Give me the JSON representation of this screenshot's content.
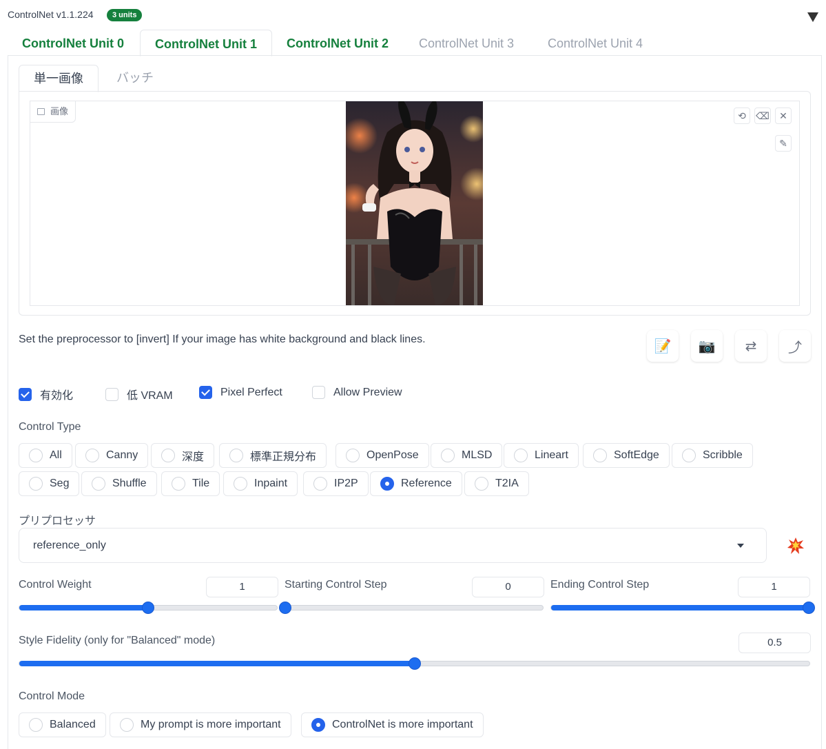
{
  "header": {
    "title": "ControlNet v1.1.224",
    "badge": "3 units"
  },
  "unit_tabs": [
    {
      "label": "ControlNet Unit 0",
      "enabled": true
    },
    {
      "label": "ControlNet Unit 1",
      "enabled": true,
      "selected": true
    },
    {
      "label": "ControlNet Unit 2",
      "enabled": true
    },
    {
      "label": "ControlNet Unit 3",
      "enabled": false
    },
    {
      "label": "ControlNet Unit 4",
      "enabled": false
    }
  ],
  "image_tabs": [
    {
      "label": "単一画像",
      "selected": true
    },
    {
      "label": "バッチ"
    }
  ],
  "image_panel": {
    "label": "画像"
  },
  "hint": "Set the preprocessor to [invert] If your image has white background and black lines.",
  "options": {
    "enable": {
      "label": "有効化",
      "checked": true
    },
    "low_vram": {
      "label": "低 VRAM",
      "checked": false
    },
    "pixel_perfect": {
      "label": "Pixel Perfect",
      "checked": true
    },
    "allow_preview": {
      "label": "Allow Preview",
      "checked": false
    }
  },
  "control_type": {
    "label": "Control Type",
    "selected": "Reference",
    "items": [
      "All",
      "Canny",
      "深度",
      "標準正規分布",
      "OpenPose",
      "MLSD",
      "Lineart",
      "SoftEdge",
      "Scribble",
      "Seg",
      "Shuffle",
      "Tile",
      "Inpaint",
      "IP2P",
      "Reference",
      "T2IA"
    ]
  },
  "preprocessor": {
    "label": "プリプロセッサ",
    "value": "reference_only"
  },
  "sliders": {
    "control_weight": {
      "label": "Control Weight",
      "value": "1",
      "fraction": 0.5
    },
    "starting_step": {
      "label": "Starting Control Step",
      "value": "0",
      "fraction": 0.0
    },
    "ending_step": {
      "label": "Ending Control Step",
      "value": "1",
      "fraction": 1.0
    },
    "style_fidelity": {
      "label": "Style Fidelity (only for \"Balanced\" mode)",
      "value": "0.5",
      "fraction": 0.5
    }
  },
  "control_mode": {
    "label": "Control Mode",
    "selected": "ControlNet is more important",
    "items": [
      "Balanced",
      "My prompt is more important",
      "ControlNet is more important"
    ]
  },
  "colors": {
    "accent": "#2563eb",
    "slider": "#1d6df0",
    "unit_enabled": "#15803d",
    "unit_disabled": "#9ca3af"
  }
}
